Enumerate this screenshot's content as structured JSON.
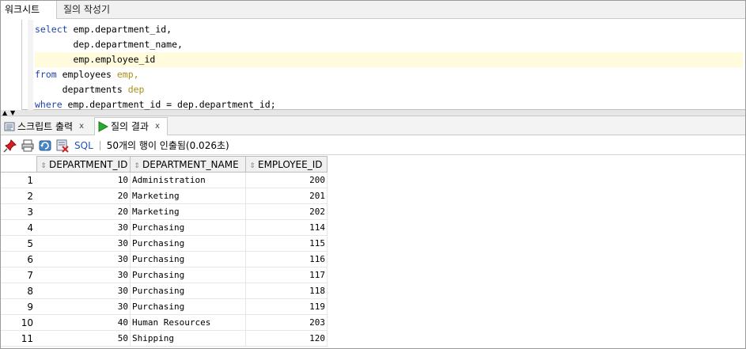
{
  "tabs": {
    "worksheet": "워크시트",
    "query_builder": "질의 작성기"
  },
  "editor": {
    "lines": [
      {
        "kw": "select",
        "rest": " emp.department_id,",
        "alias": ""
      },
      {
        "kw": "",
        "rest": "       dep.department_name,",
        "alias": ""
      },
      {
        "kw": "",
        "rest": "       emp.employee_id",
        "alias": ""
      },
      {
        "kw": "from",
        "rest": " employees ",
        "alias": "emp,"
      },
      {
        "kw": "",
        "rest": "     departments ",
        "alias": "dep"
      },
      {
        "kw": "where",
        "rest": " emp.department_id = dep.department_id;",
        "alias": ""
      }
    ]
  },
  "result_tabs": {
    "script_output": "스크립트 출력",
    "query_result": "질의 결과",
    "close": "x"
  },
  "toolbar": {
    "sql_label": "SQL",
    "status": "50개의 행이 인출됨(0.026초)"
  },
  "grid": {
    "columns": [
      "DEPARTMENT_ID",
      "DEPARTMENT_NAME",
      "EMPLOYEE_ID"
    ],
    "rows": [
      {
        "n": "1",
        "dept_id": "10",
        "dept_name": "Administration",
        "emp_id": "200"
      },
      {
        "n": "2",
        "dept_id": "20",
        "dept_name": "Marketing",
        "emp_id": "201"
      },
      {
        "n": "3",
        "dept_id": "20",
        "dept_name": "Marketing",
        "emp_id": "202"
      },
      {
        "n": "4",
        "dept_id": "30",
        "dept_name": "Purchasing",
        "emp_id": "114"
      },
      {
        "n": "5",
        "dept_id": "30",
        "dept_name": "Purchasing",
        "emp_id": "115"
      },
      {
        "n": "6",
        "dept_id": "30",
        "dept_name": "Purchasing",
        "emp_id": "116"
      },
      {
        "n": "7",
        "dept_id": "30",
        "dept_name": "Purchasing",
        "emp_id": "117"
      },
      {
        "n": "8",
        "dept_id": "30",
        "dept_name": "Purchasing",
        "emp_id": "118"
      },
      {
        "n": "9",
        "dept_id": "30",
        "dept_name": "Purchasing",
        "emp_id": "119"
      },
      {
        "n": "10",
        "dept_id": "40",
        "dept_name": "Human Resources",
        "emp_id": "203"
      },
      {
        "n": "11",
        "dept_id": "50",
        "dept_name": "Shipping",
        "emp_id": "120"
      }
    ]
  },
  "colors": {
    "keyword": "#1f43ad",
    "alias": "#a9901a",
    "highlight_line": "#fffbdc",
    "run_icon": "#2ea82e"
  },
  "icons": [
    "pin-icon",
    "print-icon",
    "refresh-icon",
    "export-icon",
    "script-icon",
    "run-icon",
    "sort-icon"
  ]
}
